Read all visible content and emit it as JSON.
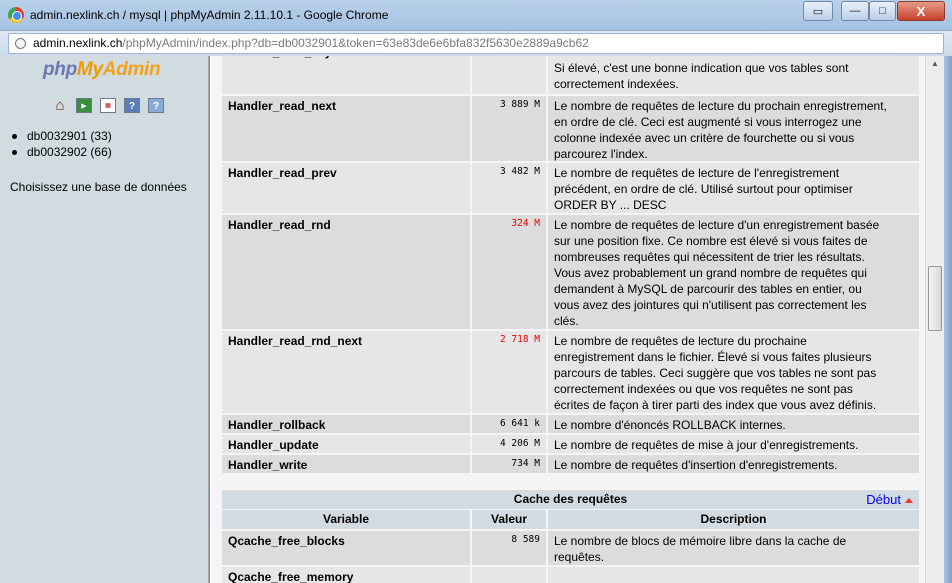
{
  "window": {
    "title": "admin.nexlink.ch / mysql | phpMyAdmin 2.11.10.1 - Google Chrome",
    "close_glyph": "X",
    "min_glyph": "—",
    "max_glyph": "□"
  },
  "address_bar": {
    "host": "admin.nexlink.ch",
    "path": "/phpMyAdmin/index.php?db=db0032901&token=63e83de6e6bfa832f5630e2889a9cb62"
  },
  "sidebar": {
    "logo_php": "php",
    "logo_my": "My",
    "logo_admin": "Admin",
    "databases": [
      {
        "label": "db0032901 (33)"
      },
      {
        "label": "db0032902 (66)"
      }
    ],
    "hint": "Choisissez une base de données"
  },
  "status_rows": [
    {
      "name": "Handler_read_key",
      "value": "",
      "desc_lines": [
        "",
        "Si élevé, c'est une bonne indication que vos tables sont",
        "correctement indexées."
      ]
    },
    {
      "name": "Handler_read_next",
      "value": "3 889 M",
      "desc_lines": [
        "Le nombre de requêtes de lecture du prochain enregistrement,",
        "en ordre de clé. Ceci est augmenté si vous interrogez une",
        "colonne indexée avec un critère de fourchette ou si vous",
        "parcourez l'index."
      ]
    },
    {
      "name": "Handler_read_prev",
      "value": "3 482 M",
      "desc_lines": [
        "Le nombre de requêtes de lecture de l'enregistrement",
        "précédent, en ordre de clé. Utilisé surtout pour optimiser",
        "ORDER BY ... DESC"
      ]
    },
    {
      "name": "Handler_read_rnd",
      "value": "324 M",
      "desc_lines": [
        "Le nombre de requêtes de lecture d'un enregistrement basée",
        "sur une position fixe. Ce nombre est élevé si vous faites de",
        "nombreuses requêtes qui nécessitent de trier les résultats.",
        "Vous avez probablement un grand nombre de requêtes qui",
        "demandent à MySQL de parcourir des tables en entier, ou",
        "vous avez des jointures qui n'utilisent pas correctement les",
        "clés."
      ]
    },
    {
      "name": "Handler_read_rnd_next",
      "value": "2 718 M",
      "desc_lines": [
        "Le nombre de requêtes de lecture du prochaine",
        "enregistrement dans le fichier. Élevé si vous faites plusieurs",
        "parcours de tables. Ceci suggère que vos tables ne sont pas",
        "correctement indexées ou que vos requêtes ne sont pas",
        "écrites de façon à tirer parti des index que vous avez définis."
      ]
    },
    {
      "name": "Handler_rollback",
      "value": "6 641 k",
      "desc_lines": [
        "Le nombre d'énoncés ROLLBACK internes."
      ]
    },
    {
      "name": "Handler_update",
      "value": "4 206 M",
      "desc_lines": [
        "Le nombre de requêtes de mise à jour d'enregistrements."
      ]
    },
    {
      "name": "Handler_write",
      "value": "734 M",
      "desc_lines": [
        "Le nombre de requêtes d'insertion d'enregistrements."
      ]
    }
  ],
  "query_cache": {
    "section_title": "Cache des requêtes",
    "top_link": "Début",
    "col_variable": "Variable",
    "col_value": "Valeur",
    "col_description": "Description",
    "rows": [
      {
        "name": "Qcache_free_blocks",
        "value": "8 589",
        "desc_lines": [
          "Le nombre de blocs de mémoire libre dans la cache de",
          "requêtes."
        ]
      },
      {
        "name": "Qcache_free_memory",
        "value": "",
        "desc_lines": [
          ""
        ]
      }
    ]
  },
  "colors": {
    "warning_value": "#ee0000",
    "link": "#0000ee",
    "row_dark": "#dcdcdc",
    "row_light": "#e6e6e6",
    "header_bg": "#d2dbe2"
  }
}
